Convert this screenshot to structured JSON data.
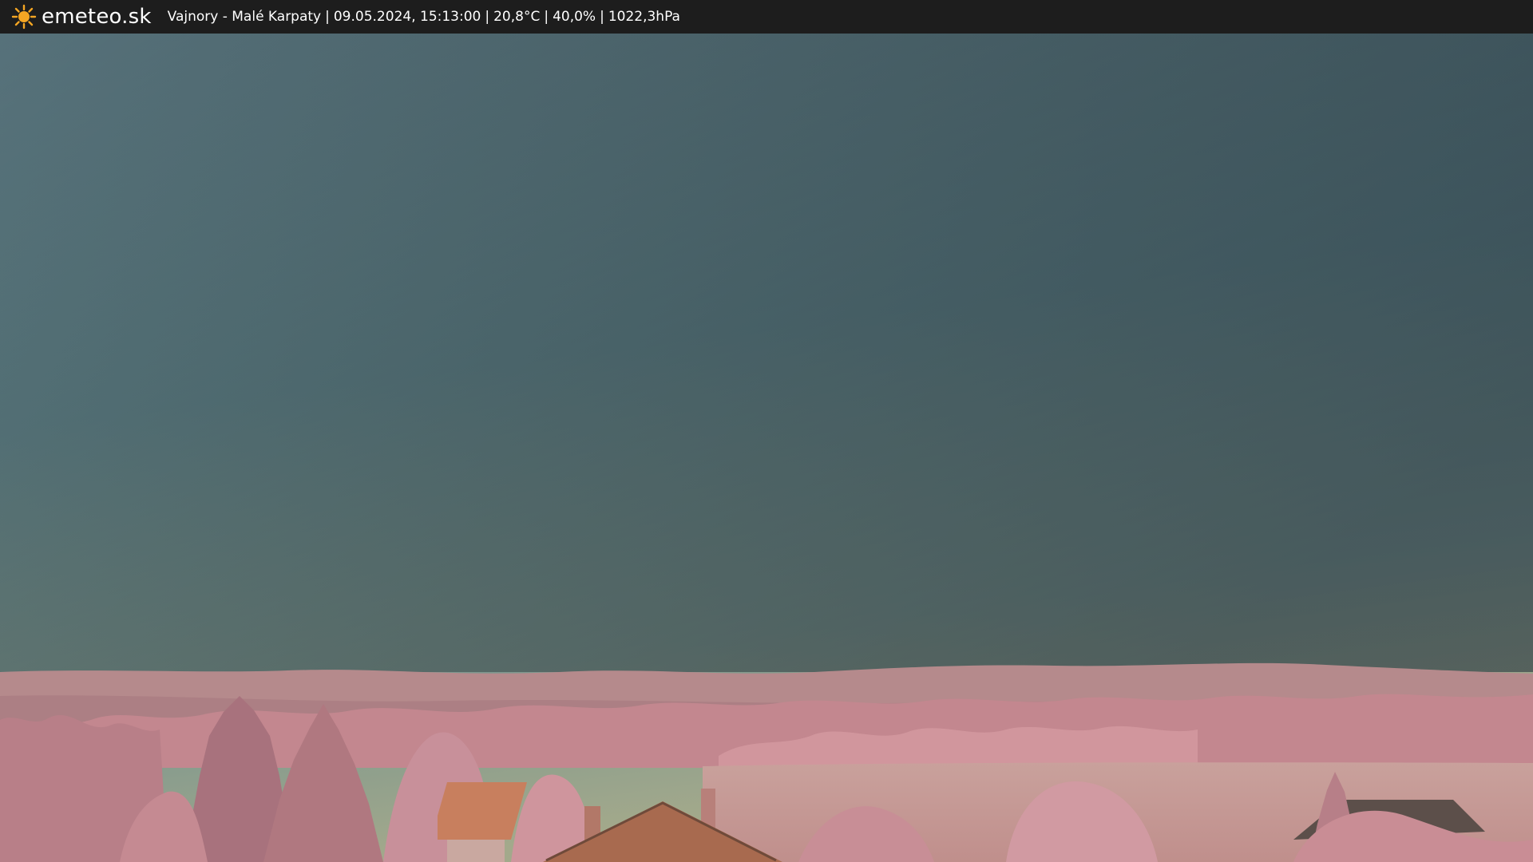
{
  "header": {
    "brand": "emeteo.sk",
    "location": "Vajnory - Malé Karpaty",
    "datetime": "09.05.2024, 15:13:00",
    "temperature": "20,8°C",
    "humidity": "40,0%",
    "pressure": "1022,3hPa",
    "separator": "|",
    "logo_icon": "sun-icon"
  },
  "colors": {
    "bar_background": "#1d1d1d",
    "bar_text": "#ffffff",
    "sun": "#f5a623",
    "sky_top": "#3d4f5c",
    "sky_mid": "#5f8086",
    "sky_horizon": "#a0a98c",
    "hills": "#b98b8e",
    "foliage": "#c88e94",
    "field": "#c79c98",
    "roof": "#a86a4f"
  }
}
